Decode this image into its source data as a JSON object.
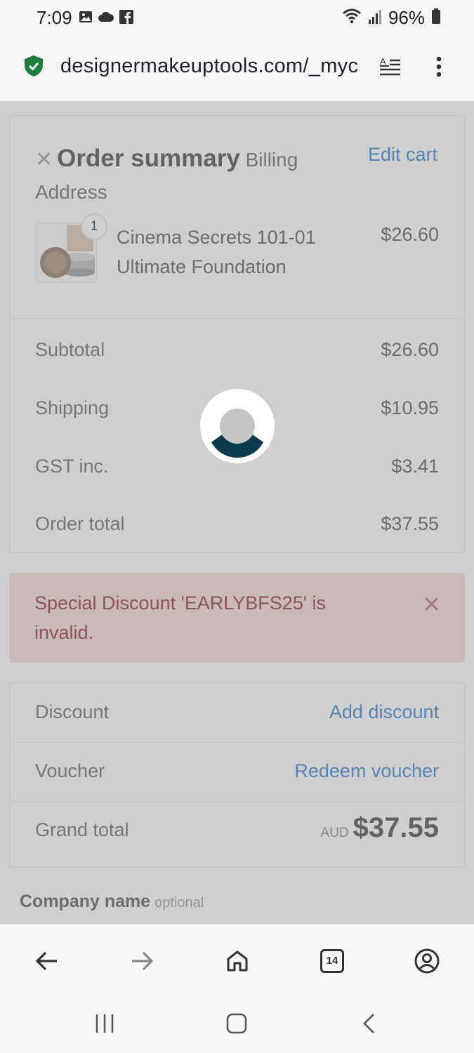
{
  "status_bar": {
    "time": "7:09",
    "battery": "96%",
    "icons": [
      "image-icon",
      "cloud-icon",
      "facebook-icon",
      "wifi-icon",
      "signal-icon",
      "battery-icon"
    ]
  },
  "browser": {
    "url": "designermakeuptools.com/_myc",
    "icons": [
      "shield-check-icon",
      "reader-mode-icon",
      "more-vert-icon"
    ]
  },
  "order_summary": {
    "close_symbol": "✕",
    "title": "Order summary",
    "subtitle": "Billing Address",
    "edit_cart_label": "Edit cart",
    "item": {
      "quantity": "1",
      "name": "Cinema Secrets 101-01 Ultimate Foundation",
      "price": "$26.60"
    },
    "rows": [
      {
        "label": "Subtotal",
        "value": "$26.60"
      },
      {
        "label": "Shipping",
        "value": "$10.95"
      },
      {
        "label": "GST inc.",
        "value": "$3.41"
      },
      {
        "label": "Order total",
        "value": "$37.55"
      }
    ]
  },
  "alert": {
    "message": "Special Discount 'EARLYBFS25' is invalid.",
    "close_symbol": "✕"
  },
  "totals": {
    "discount_label": "Discount",
    "discount_action": "Add discount",
    "voucher_label": "Voucher",
    "voucher_action": "Redeem voucher",
    "grand_total_label": "Grand total",
    "currency": "AUD",
    "grand_total_value": "$37.55"
  },
  "form": {
    "company_label": "Company name",
    "company_hint": "optional"
  },
  "toolbar": {
    "tab_count": "14",
    "icons": [
      "back-arrow-icon",
      "forward-arrow-icon",
      "home-icon",
      "tabs-icon",
      "account-icon"
    ]
  },
  "colors": {
    "accent_link": "#2f7fd3",
    "alert_bg": "#f8d7da",
    "spinner_fill": "#0b3a4d",
    "shield": "#1e7d3a"
  }
}
